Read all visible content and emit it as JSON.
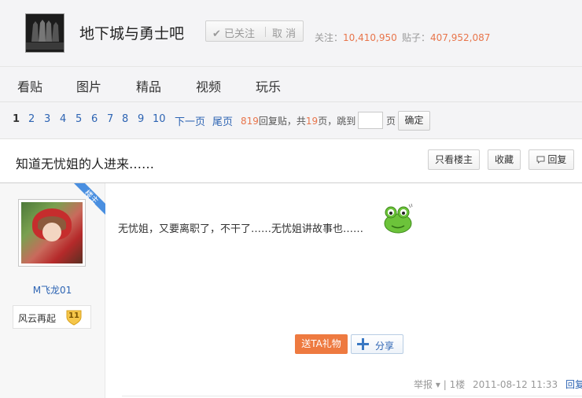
{
  "header": {
    "forum_name": "地下城与勇士吧",
    "followed_label": "已关注",
    "cancel_label": "取 消",
    "follow_count_label": "关注：",
    "follow_count": "10,410,950",
    "post_count_label": "贴子：",
    "post_count": "407,952,087"
  },
  "nav": {
    "items": [
      "看贴",
      "图片",
      "精品",
      "视频",
      "玩乐"
    ]
  },
  "pager": {
    "pages": [
      "1",
      "2",
      "3",
      "4",
      "5",
      "6",
      "7",
      "8",
      "9",
      "10"
    ],
    "next": "下一页",
    "last": "尾页",
    "reply_count": "819",
    "reply_label": "回复贴，共",
    "page_total": "19",
    "page_label": "页，跳到",
    "page_unit": "页",
    "confirm": "确定"
  },
  "thread": {
    "title": "知道无忧姐的人进来……",
    "only_op_label": "只看楼主",
    "collect_label": "收藏",
    "reply_label": "回复"
  },
  "post": {
    "op_tag": "楼主",
    "author": "M飞龙01",
    "level_title": "风云再起",
    "level": "11",
    "content": "无忧姐，又要离职了，不干了……无忧姐讲故事也……",
    "gift_label": "送TA礼物",
    "share_label": "分享",
    "report_label": "举报",
    "floor": "1楼",
    "time": "2011-08-12 11:33",
    "reply_label": "回复"
  },
  "colors": {
    "accent_orange": "#e8754b",
    "link_blue": "#2d64b3",
    "gift_orange": "#ee7a40",
    "op_tag_blue": "#4a8fe0"
  }
}
